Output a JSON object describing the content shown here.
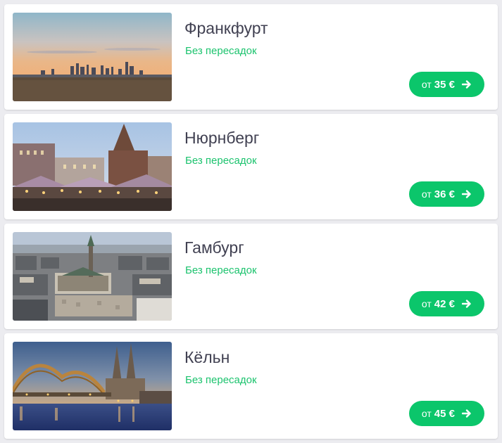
{
  "offers": [
    {
      "city": "Франкфурт",
      "transfer": "Без пересадок",
      "price_prefix": "от",
      "price": "35 €",
      "image": "frankfurt-skyline-photo"
    },
    {
      "city": "Нюрнберг",
      "transfer": "Без пересадок",
      "price_prefix": "от",
      "price": "36 €",
      "image": "nuremberg-christmas-market-photo"
    },
    {
      "city": "Гамбург",
      "transfer": "Без пересадок",
      "price_prefix": "от",
      "price": "42 €",
      "image": "hamburg-town-hall-aerial-photo"
    },
    {
      "city": "Кёльн",
      "transfer": "Без пересадок",
      "price_prefix": "от",
      "price": "45 €",
      "image": "cologne-cathedral-bridge-photo"
    }
  ],
  "colors": {
    "accent_green": "#0bc66b",
    "transfer_text": "#1cc36e",
    "city_text": "#414152",
    "background": "#ececf0"
  },
  "icons": {
    "price_button": "arrow-right-icon"
  }
}
